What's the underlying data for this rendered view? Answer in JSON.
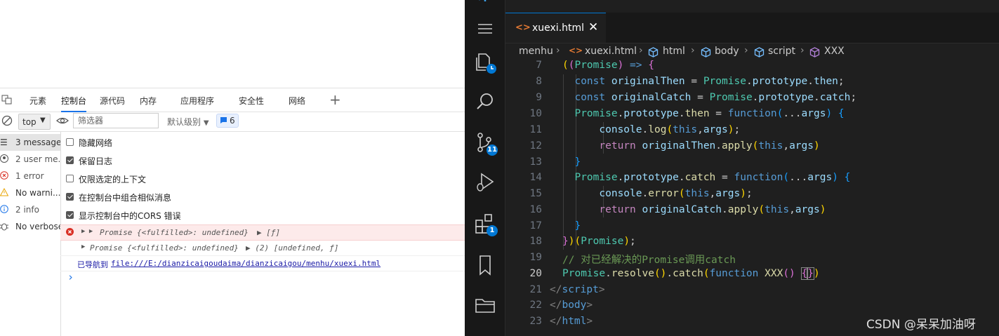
{
  "devtools": {
    "tabs": [
      "元素",
      "控制台",
      "源代码",
      "内存",
      "应用程序",
      "安全性",
      "网络"
    ],
    "active_tab": "控制台",
    "toolbar": {
      "context": "top",
      "filter_placeholder": "筛选器",
      "levels": "默认级别",
      "issues_count": "6"
    },
    "sidebar": [
      {
        "icon": "list-icon",
        "label": "3 messages"
      },
      {
        "icon": "user-icon",
        "label": "2 user me..."
      },
      {
        "icon": "error-icon",
        "label": "1 error"
      },
      {
        "icon": "warning-icon",
        "label": "No warni..."
      },
      {
        "icon": "info-icon",
        "label": "2 info"
      },
      {
        "icon": "bug-icon",
        "label": "No verbose"
      }
    ],
    "settings": [
      {
        "label": "隐藏网络",
        "checked": false
      },
      {
        "label": "保留日志",
        "checked": true
      },
      {
        "label": "仅限选定的上下文",
        "checked": false
      },
      {
        "label": "在控制台中组合相似消息",
        "checked": true
      },
      {
        "label": "显示控制台中的CORS 错误",
        "checked": true
      }
    ],
    "log": {
      "error_line": "Promise {<fulfilled>: undefined}",
      "error_extra": "▶ [ƒ]",
      "normal_line": "Promise {<fulfilled>: undefined}",
      "normal_extra": "▶ (2) [undefined, ƒ]",
      "nav_text": "已导航到",
      "nav_link": "file:///E:/dianzicaigoudaima/dianzicaigou/menhu/xuexi.html",
      "prompt": "›"
    }
  },
  "vscode": {
    "tab": "xuexi.html",
    "breadcrumbs": [
      "menhu",
      "xuexi.html",
      "html",
      "body",
      "script",
      "XXX"
    ],
    "badges": {
      "scm": "11",
      "extensions": "1"
    },
    "line_numbers": [
      "7",
      "8",
      "9",
      "10",
      "11",
      "12",
      "13",
      "14",
      "15",
      "16",
      "17",
      "18",
      "19",
      "20",
      "21",
      "22",
      "23"
    ],
    "current_line": "20",
    "watermark": "CSDN @呆呆加油呀"
  }
}
